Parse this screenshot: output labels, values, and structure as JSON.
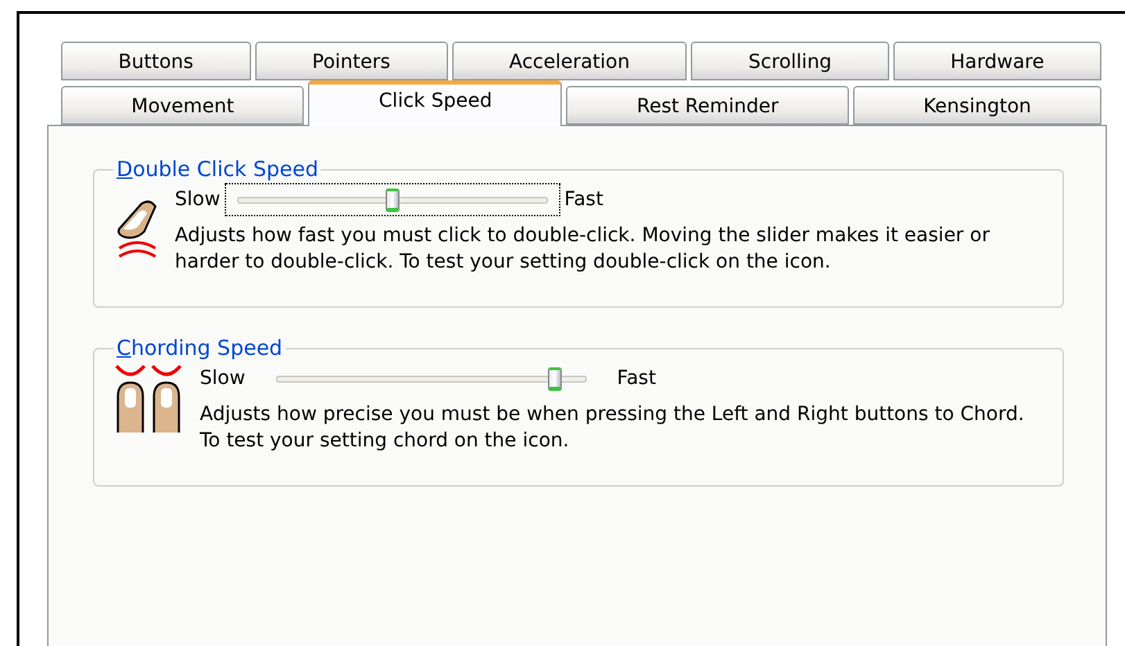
{
  "tab_rows": [
    [
      {
        "label": "Buttons",
        "selected": false
      },
      {
        "label": "Pointers",
        "selected": false
      },
      {
        "label": "Acceleration",
        "selected": false
      },
      {
        "label": "Scrolling",
        "selected": false
      },
      {
        "label": "Hardware",
        "selected": false
      }
    ],
    [
      {
        "label": "Movement",
        "selected": false
      },
      {
        "label": "Click Speed",
        "selected": true
      },
      {
        "label": "Rest Reminder",
        "selected": false
      },
      {
        "label": "Kensington",
        "selected": false
      }
    ]
  ],
  "groups": [
    {
      "kind": "double-click",
      "title": "Double Click Speed",
      "slow_label": "Slow",
      "fast_label": "Fast",
      "level": 0.5,
      "focused": true,
      "description": "Adjusts how fast you must click to double-click. Moving the slider makes it easier or harder to double-click. To test your setting double-click on the icon."
    },
    {
      "kind": "chord",
      "title": "Chording Speed",
      "slow_label": "Slow",
      "fast_label": "Fast",
      "level": 0.9,
      "focused": false,
      "description": "Adjusts how precise you must be when pressing the Left and Right buttons to Chord. To test your setting chord on the icon."
    }
  ]
}
